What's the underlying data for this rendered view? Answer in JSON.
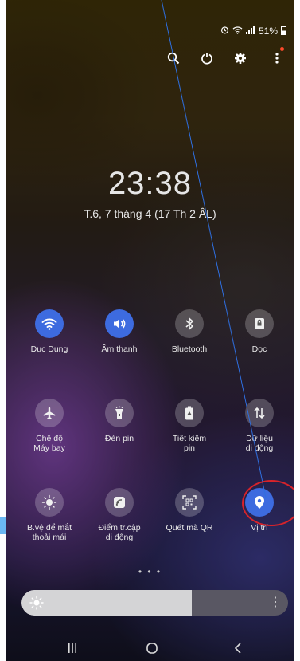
{
  "status_bar": {
    "battery_text": "51%",
    "icons": [
      "alarm-icon",
      "wifi-icon",
      "signal-icon",
      "battery-icon"
    ]
  },
  "top_actions": [
    "search-icon",
    "power-icon",
    "settings-icon",
    "more-icon"
  ],
  "lock": {
    "time": "23:38",
    "date": "T.6, 7 tháng 4 (17 Th 2 ÂL)"
  },
  "tiles": [
    {
      "label": "Duc Dung",
      "icon": "wifi-icon",
      "on": true
    },
    {
      "label": "Âm thanh",
      "icon": "sound-icon",
      "on": true
    },
    {
      "label": "Bluetooth",
      "icon": "bluetooth-icon",
      "on": false
    },
    {
      "label": "Dọc",
      "icon": "rotation-lock-icon",
      "on": false
    },
    {
      "label": "Chế độ\nMáy bay",
      "icon": "airplane-icon",
      "on": false
    },
    {
      "label": "Đèn pin",
      "icon": "flashlight-icon",
      "on": false
    },
    {
      "label": "Tiết kiệm\npin",
      "icon": "battery-saver-icon",
      "on": false
    },
    {
      "label": "Dữ liệu\ndi động",
      "icon": "mobile-data-icon",
      "on": false
    },
    {
      "label": "B.vệ để mắt\nthoải mái",
      "icon": "eye-comfort-icon",
      "on": false
    },
    {
      "label": "Điểm tr.cập\ndi động",
      "icon": "hotspot-icon",
      "on": false
    },
    {
      "label": "Quét mã QR",
      "icon": "qr-scan-icon",
      "on": false
    },
    {
      "label": "Vị trí",
      "icon": "location-icon",
      "on": true
    }
  ],
  "pager": "• • •",
  "brightness": {
    "level_fraction": 0.64
  },
  "navbar": [
    "recents-icon",
    "home-icon",
    "back-icon"
  ],
  "colors": {
    "accent": "#3d6bdf",
    "annotation_red": "#d8232a",
    "annotation_line": "#2f6fe0"
  }
}
